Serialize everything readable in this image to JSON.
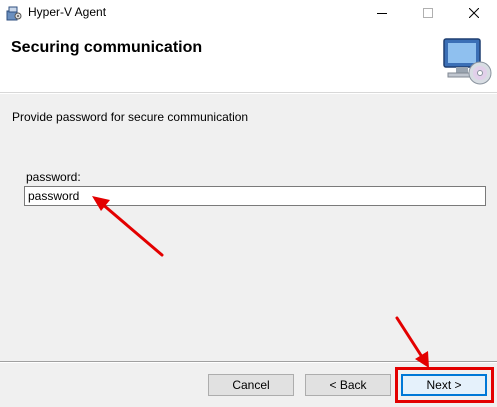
{
  "window": {
    "title": "Hyper-V Agent",
    "icon": "installer-icon"
  },
  "header": {
    "title": "Securing communication",
    "graphic": "computer-cd-icon"
  },
  "main": {
    "prompt": "Provide password for secure communication",
    "password_label": "password:",
    "password_value": "password"
  },
  "footer": {
    "cancel_label": "Cancel",
    "back_label": "< Back",
    "next_label": "Next >"
  },
  "annotations": {
    "color": "#e30000"
  }
}
